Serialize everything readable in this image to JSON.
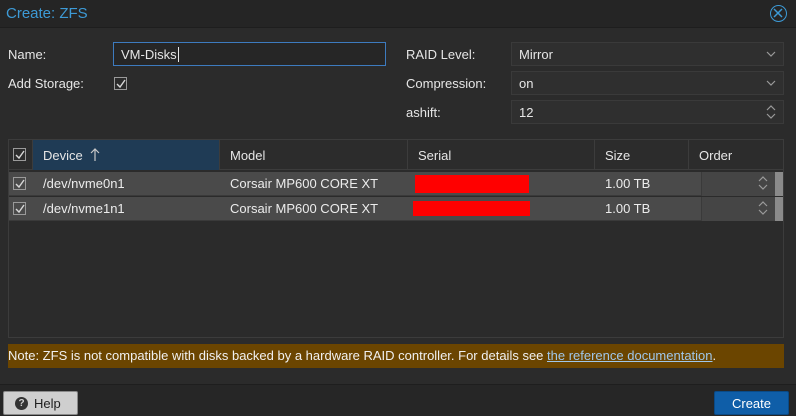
{
  "window": {
    "title": "Create: ZFS"
  },
  "form": {
    "name_label": "Name:",
    "name_value": "VM-Disks",
    "add_storage_label": "Add Storage:",
    "add_storage_checked": true,
    "raid_label": "RAID Level:",
    "raid_value": "Mirror",
    "compression_label": "Compression:",
    "compression_value": "on",
    "ashift_label": "ashift:",
    "ashift_value": "12"
  },
  "grid": {
    "columns": [
      "Device",
      "Model",
      "Serial",
      "Size",
      "Order"
    ],
    "sorted_column": "Device",
    "rows": [
      {
        "device": "/dev/nvme0n1",
        "model": "Corsair MP600 CORE XT",
        "serial": "",
        "size": "1.00 TB",
        "order": "",
        "checked": true
      },
      {
        "device": "/dev/nvme1n1",
        "model": "Corsair MP600 CORE XT",
        "serial": "",
        "size": "1.00 TB",
        "order": "",
        "checked": true
      }
    ]
  },
  "note": {
    "text": "Note: ZFS is not compatible with disks backed by a hardware RAID controller. For details see ",
    "link": "the reference documentation",
    "suffix": "."
  },
  "footer": {
    "help_label": "Help",
    "create_label": "Create"
  },
  "colors": {
    "accent": "#3d9ad6",
    "primary_button": "#0f5ea8",
    "note_background": "#6b4500",
    "redaction": "#ff0000"
  }
}
